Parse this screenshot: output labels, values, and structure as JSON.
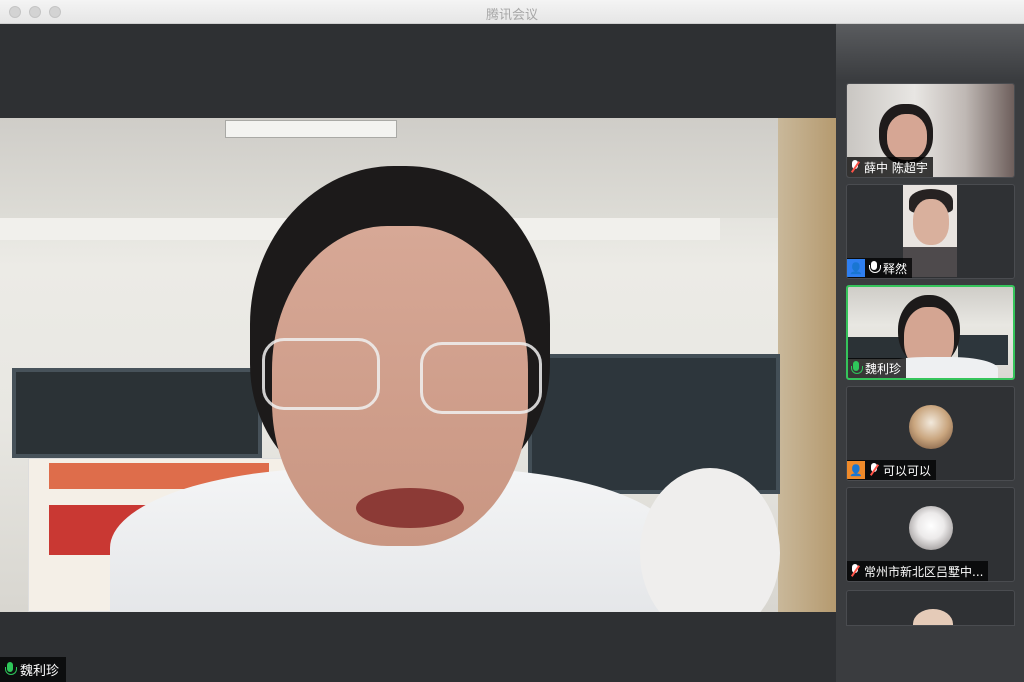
{
  "window": {
    "title": "腾讯会议"
  },
  "main_video": {
    "speaker_name": "魏利珍",
    "mic_state": "active"
  },
  "participants": [
    {
      "name": "薛中 陈超宇",
      "mic_state": "muted",
      "badge": ""
    },
    {
      "name": "释然",
      "mic_state": "on",
      "badge": "person-icon"
    },
    {
      "name": "魏利珍",
      "mic_state": "active",
      "badge": "",
      "active": true
    },
    {
      "name": "可以可以",
      "mic_state": "muted",
      "badge": "person-icon"
    },
    {
      "name": "常州市新北区吕墅中...",
      "mic_state": "muted",
      "badge": ""
    }
  ],
  "colors": {
    "active_speaker": "#35c45b",
    "mic_muted_slash": "#ff5348",
    "host_badge_blue": "#2f7ff0",
    "host_badge_orange": "#ef8a2a"
  }
}
